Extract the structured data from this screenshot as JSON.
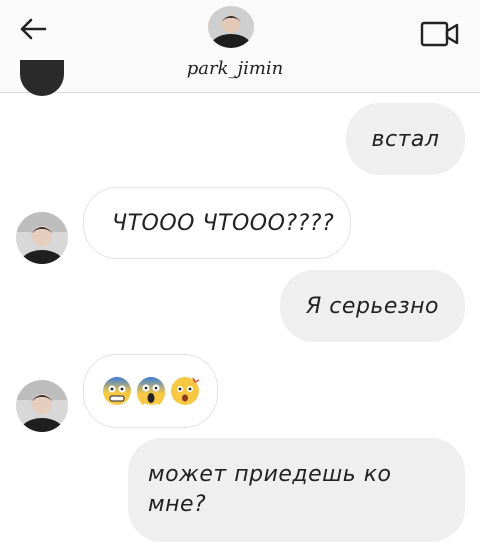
{
  "header": {
    "username": "park_jimin",
    "back_icon": "arrow-left-icon",
    "video_icon": "video-camera-icon"
  },
  "messages": [
    {
      "from": "me",
      "text": "встал"
    },
    {
      "from": "them",
      "text": "ЧТООО ЧТООО????"
    },
    {
      "from": "me",
      "text": "Я серьезно"
    },
    {
      "from": "them",
      "emojis": [
        "anxious-face-emoji",
        "screaming-face-emoji",
        "astonished-face-emoji"
      ]
    },
    {
      "from": "me",
      "text": "может приедешь ко мне?"
    }
  ],
  "colors": {
    "outgoing_bubble": "#efefef",
    "incoming_border": "#e3e3e3",
    "header_bg": "#fafafa"
  }
}
